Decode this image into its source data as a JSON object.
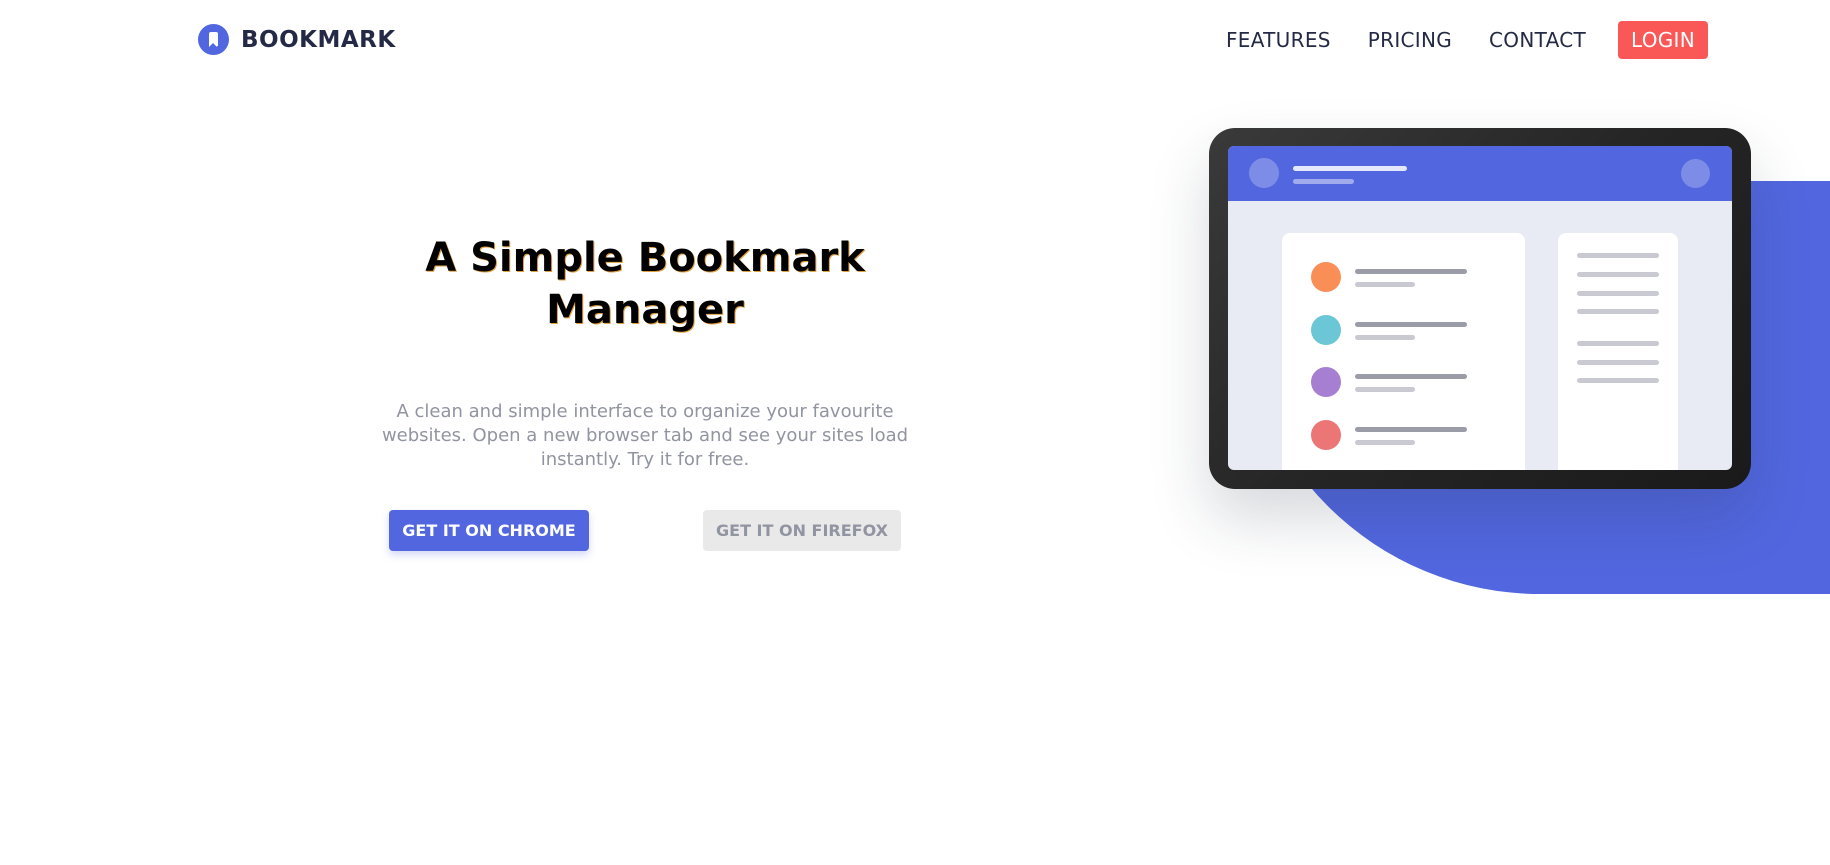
{
  "header": {
    "logo_text": "BOOKMARK",
    "logo_icon": "bookmark-icon",
    "nav": [
      {
        "label": "FEATURES"
      },
      {
        "label": "PRICING"
      },
      {
        "label": "CONTACT"
      }
    ],
    "login_label": "LOGIN"
  },
  "hero": {
    "title": "A Simple Bookmark Manager",
    "subtitle": "A clean and simple interface to organize your favourite websites. Open a new browser tab and see your sites load instantly. Try it for free.",
    "chrome_button": "GET IT ON CHROME",
    "firefox_button": "GET IT ON FIREFOX"
  },
  "colors": {
    "primary": "#5267DF",
    "accent": "#FA5757",
    "text_dark": "#242A45",
    "text_muted": "#9194A1",
    "dot_colors": [
      "#F98F57",
      "#6BC7D6",
      "#A67FD3",
      "#EC7676"
    ]
  }
}
